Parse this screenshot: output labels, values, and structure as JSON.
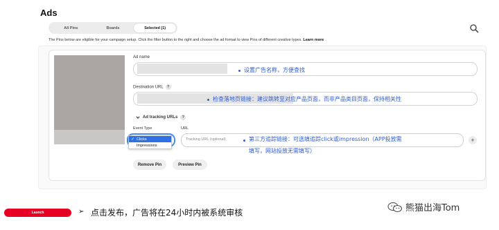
{
  "header": {
    "title": "Ads"
  },
  "tabs": [
    {
      "label": "All Pins",
      "active": false
    },
    {
      "label": "Boards",
      "active": false
    },
    {
      "label": "Selected (1)",
      "active": true
    }
  ],
  "info": {
    "text": "The Pins below are eligible for your campaign setup. Click the filter button to the right and choose the ad format to view Pins of different creative types.",
    "link": "Learn more"
  },
  "form": {
    "ad_name_label": "Ad name",
    "destination_url_label": "Destination URL",
    "tracking_label": "Ad tracking URLs",
    "event_type_label": "Event Type",
    "url_label": "URL",
    "url_placeholder": "Tracking URL (optional)",
    "event_options": [
      "Clicks",
      "Impressions"
    ],
    "selected_event": "Clicks",
    "help_glyph": "?",
    "add_glyph": "+",
    "check_glyph": "✓"
  },
  "actions": {
    "remove": "Remove Pin",
    "preview": "Preview Pin",
    "launch": "Launch"
  },
  "annotations": {
    "ad_name": "设置广告名称，方便查找",
    "destination_url": "检查落地页链接：建议跳转至对应产品页面，而非产品类目页面，保持相关性",
    "tracking_line1": "第三方追踪链接：可选填追踪click或impression（APP投放需",
    "tracking_line2": "填写，网站投放无需填写）",
    "launch_arrow": "➢",
    "launch_note": "点击发布，广告将在24小时内被系统审核"
  },
  "watermark": {
    "text": "熊猫出海Tom"
  },
  "colors": {
    "brand_red": "#e60023",
    "annotation_blue": "#2f5bd0",
    "focus_blue": "#4a8af0"
  }
}
